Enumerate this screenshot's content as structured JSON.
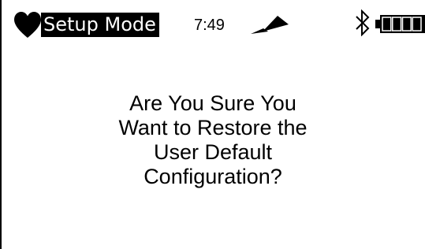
{
  "status_bar": {
    "mode_label": "Setup Mode",
    "time": "7:49",
    "icons": {
      "heart": "heart-icon",
      "signal": "signal-icon",
      "bluetooth": "bluetooth-icon",
      "battery": "battery-icon"
    },
    "battery_level_bars": 4,
    "battery_level_max": 4
  },
  "dialog": {
    "lines": [
      "Are You Sure You",
      "Want to Restore the",
      "User Default",
      "Configuration?"
    ]
  },
  "colors": {
    "background": "#ffffff",
    "foreground": "#000000",
    "badge_text": "#ffffff"
  }
}
